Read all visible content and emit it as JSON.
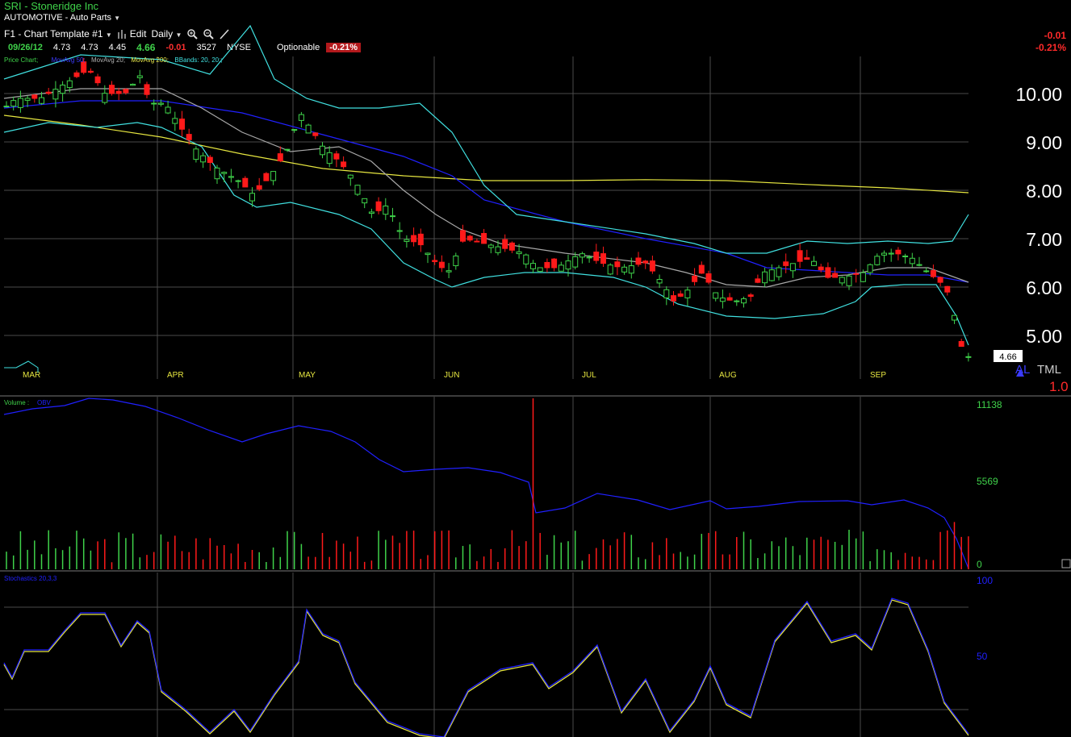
{
  "header": {
    "title": "SRI - Stoneridge Inc",
    "sector": "AUTOMOTIVE - Auto Parts",
    "template": "F1 - Chart Template #1",
    "edit_label": "Edit",
    "period": "Daily",
    "optionable": "Optionable",
    "change_pct_badge": "-0.21%"
  },
  "quote": {
    "date": "09/26/12",
    "open": "4.73",
    "high": "4.73",
    "low": "4.45",
    "last": "4.66",
    "change": "-0.01",
    "volume": "3527",
    "exchange": "NYSE"
  },
  "right_change": {
    "change": "-0.01",
    "pct": "-0.21%"
  },
  "price_panel": {
    "legend": [
      {
        "text": "Price Chart",
        "color": "#3fd24a"
      },
      {
        "text": "MovAvg 50",
        "color": "#3b3bff"
      },
      {
        "text": "MovAvg 20",
        "color": "#b0b0b0"
      },
      {
        "text": "MovAvg 200",
        "color": "#e8e84a"
      },
      {
        "text": "BBands: 20, 20;",
        "color": "#40e0e0"
      }
    ],
    "y_ticks": [
      "10.00",
      "9.00",
      "8.00",
      "7.00",
      "6.00",
      "5.00"
    ],
    "months": [
      "MAR",
      "APR",
      "MAY",
      "JUN",
      "JUL",
      "AUG",
      "SEP"
    ],
    "last_price_label": "4.66",
    "alert_text": "AL",
    "tml_text": "TML",
    "side_num": "1.0"
  },
  "volume_panel": {
    "legend": "Volume",
    "legend2": "OBV",
    "ticks": [
      "11138",
      "5569",
      "0"
    ]
  },
  "stoch_panel": {
    "legend": "Stochastics 20,3,3",
    "ticks": [
      "100",
      "50"
    ]
  },
  "colors": {
    "up": "#3fd24a",
    "down": "#ff1a1a",
    "ma50": "#2020ff",
    "ma20": "#a8a8a8",
    "ma200": "#e6e640",
    "bb": "#40e0e0",
    "grid": "#4a4a4a"
  },
  "chart_data": {
    "type": "candlestick",
    "title": "SRI - Stoneridge Inc",
    "x_range": [
      "2012-02-29",
      "2012-09-26"
    ],
    "ylim": [
      4.4,
      11.1
    ],
    "ohlc_sample": [
      {
        "date": "2012-03-01",
        "open": 9.9,
        "high": 10.1,
        "low": 9.6,
        "close": 10.0
      },
      {
        "date": "2012-03-15",
        "open": 10.1,
        "high": 10.6,
        "low": 9.9,
        "close": 10.5
      },
      {
        "date": "2012-03-29",
        "open": 10.6,
        "high": 10.7,
        "low": 9.9,
        "close": 10.0
      },
      {
        "date": "2012-04-12",
        "open": 9.5,
        "high": 9.6,
        "low": 9.2,
        "close": 9.3
      },
      {
        "date": "2012-04-20",
        "open": 8.6,
        "high": 8.9,
        "low": 8.0,
        "close": 8.7
      },
      {
        "date": "2012-05-04",
        "open": 9.0,
        "high": 9.7,
        "low": 8.9,
        "close": 9.6
      },
      {
        "date": "2012-05-18",
        "open": 8.9,
        "high": 9.0,
        "low": 8.3,
        "close": 8.4
      },
      {
        "date": "2012-06-01",
        "open": 7.3,
        "high": 7.4,
        "low": 6.7,
        "close": 6.8
      },
      {
        "date": "2012-06-15",
        "open": 6.9,
        "high": 7.2,
        "low": 6.5,
        "close": 6.7
      },
      {
        "date": "2012-07-02",
        "open": 6.5,
        "high": 6.9,
        "low": 6.3,
        "close": 6.8
      },
      {
        "date": "2012-07-20",
        "open": 6.5,
        "high": 6.7,
        "low": 6.2,
        "close": 6.6
      },
      {
        "date": "2012-08-03",
        "open": 6.1,
        "high": 6.5,
        "low": 5.8,
        "close": 6.3
      },
      {
        "date": "2012-08-17",
        "open": 6.2,
        "high": 6.9,
        "low": 6.0,
        "close": 6.5
      },
      {
        "date": "2012-08-31",
        "open": 6.4,
        "high": 6.6,
        "low": 6.2,
        "close": 6.4
      },
      {
        "date": "2012-09-14",
        "open": 6.7,
        "high": 6.9,
        "low": 6.6,
        "close": 6.8
      },
      {
        "date": "2012-09-21",
        "open": 6.0,
        "high": 6.1,
        "low": 5.9,
        "close": 6.0
      },
      {
        "date": "2012-09-24",
        "open": 5.5,
        "high": 5.5,
        "low": 5.1,
        "close": 5.1
      },
      {
        "date": "2012-09-25",
        "open": 5.0,
        "high": 5.1,
        "low": 4.7,
        "close": 4.75
      },
      {
        "date": "2012-09-26",
        "open": 4.73,
        "high": 4.73,
        "low": 4.45,
        "close": 4.66
      }
    ]
  }
}
